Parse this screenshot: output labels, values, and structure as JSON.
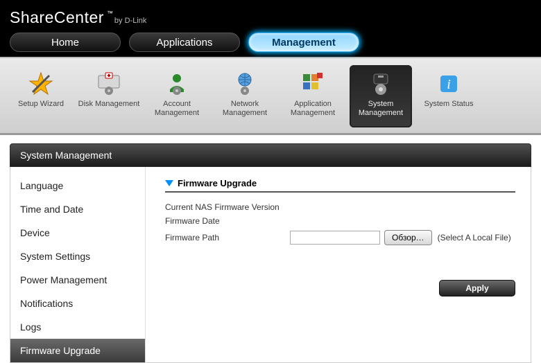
{
  "header": {
    "brand_main": "ShareCenter",
    "brand_tm": "™",
    "brand_by": "by D-Link",
    "tabs": [
      {
        "label": "Home",
        "active": false
      },
      {
        "label": "Applications",
        "active": false
      },
      {
        "label": "Management",
        "active": true
      }
    ]
  },
  "toolbar": {
    "items": [
      {
        "label": "Setup Wizard",
        "icon": "wizard-icon",
        "active": false
      },
      {
        "label": "Disk Management",
        "icon": "disk-icon",
        "active": false
      },
      {
        "label": "Account Management",
        "icon": "account-icon",
        "active": false
      },
      {
        "label": "Network Management",
        "icon": "network-icon",
        "active": false
      },
      {
        "label": "Application Management",
        "icon": "application-icon",
        "active": false
      },
      {
        "label": "System Management",
        "icon": "system-icon",
        "active": true
      },
      {
        "label": "System Status",
        "icon": "status-icon",
        "active": false
      }
    ]
  },
  "section": {
    "title": "System Management"
  },
  "sidebar": {
    "items": [
      {
        "label": "Language",
        "active": false
      },
      {
        "label": "Time and Date",
        "active": false
      },
      {
        "label": "Device",
        "active": false
      },
      {
        "label": "System Settings",
        "active": false
      },
      {
        "label": "Power Management",
        "active": false
      },
      {
        "label": "Notifications",
        "active": false
      },
      {
        "label": "Logs",
        "active": false
      },
      {
        "label": "Firmware Upgrade",
        "active": true
      }
    ]
  },
  "panel": {
    "title": "Firmware Upgrade",
    "rows": {
      "version_label": "Current NAS Firmware Version",
      "version_value": "",
      "date_label": "Firmware Date",
      "date_value": "",
      "path_label": "Firmware Path",
      "path_value": "",
      "browse_label": "Обзор…",
      "hint": "(Select A Local File)"
    },
    "apply_label": "Apply"
  }
}
